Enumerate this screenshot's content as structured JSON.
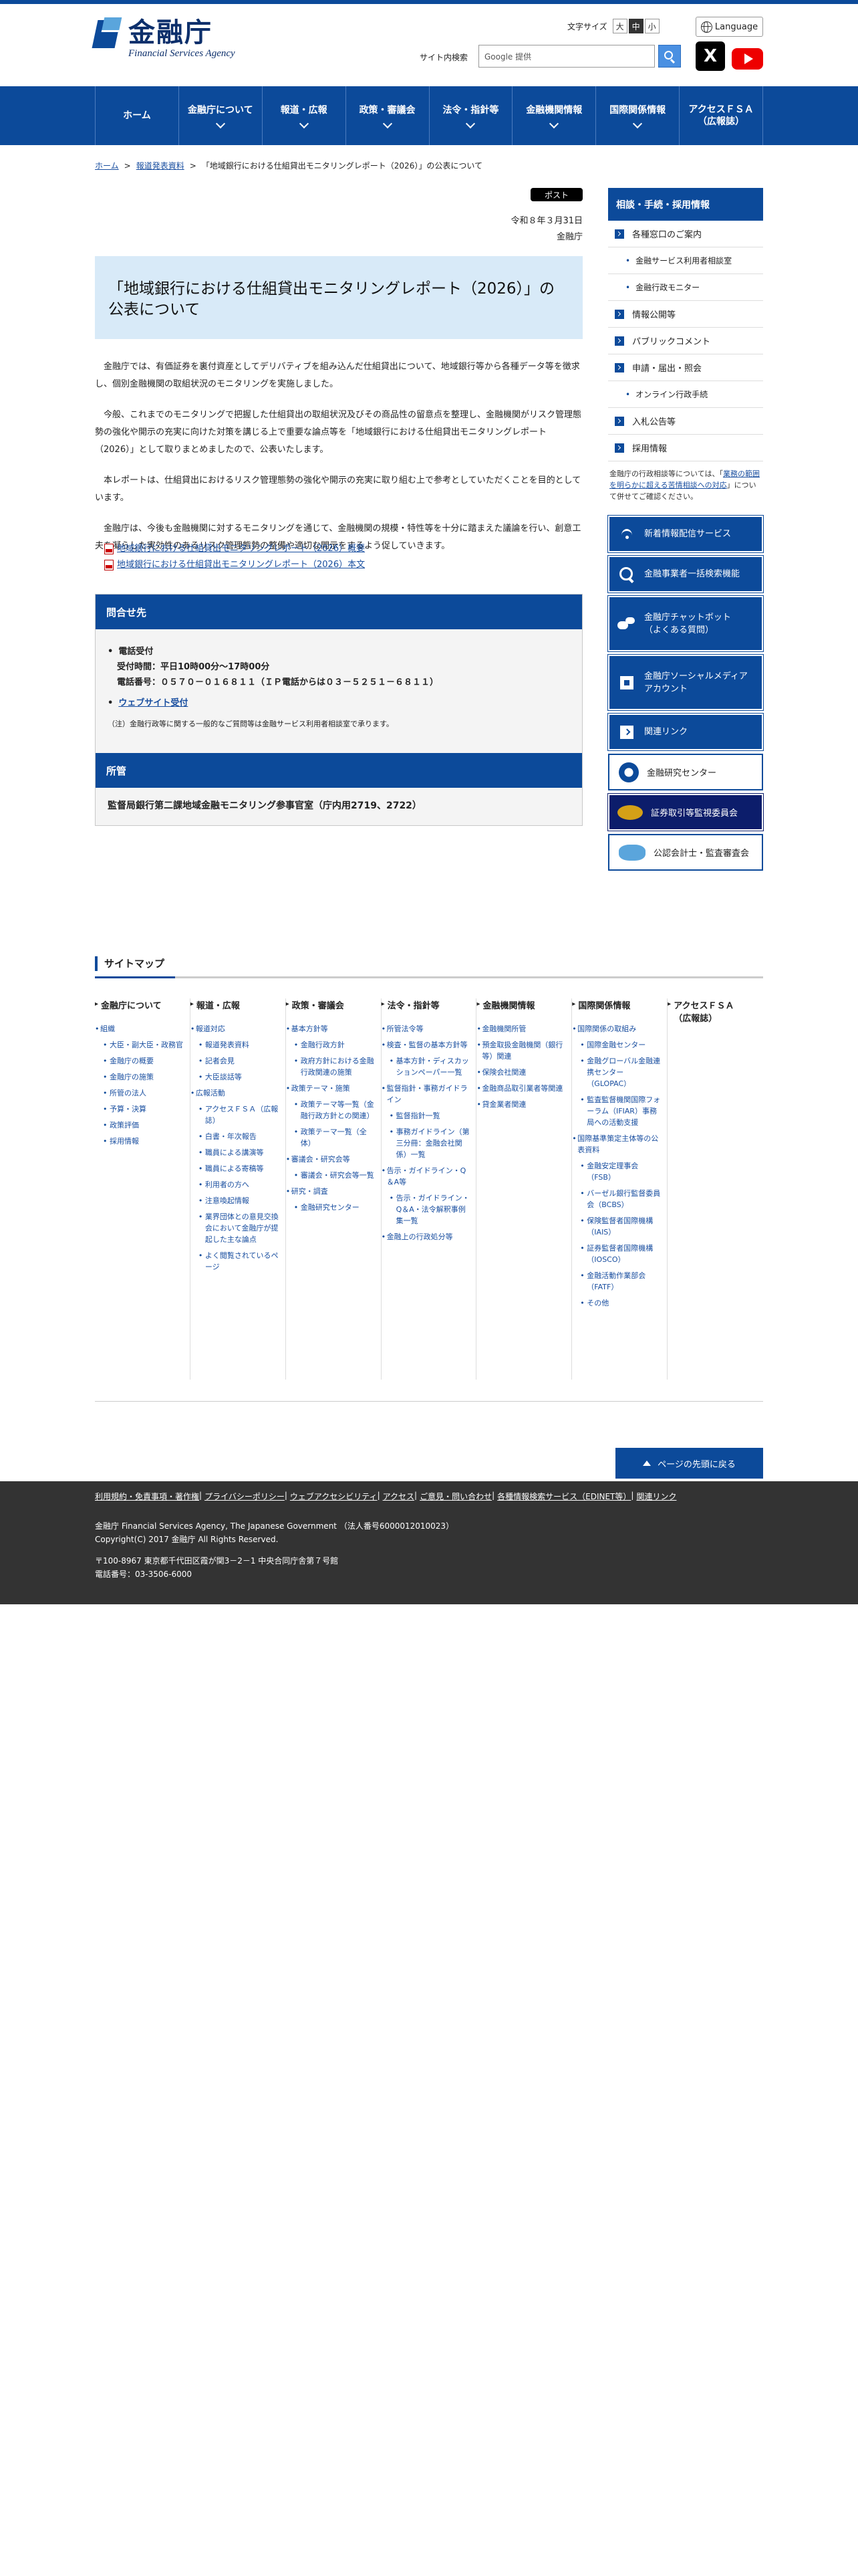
{
  "header": {
    "logo_ja": "金融庁",
    "logo_en": "Financial Services Agency",
    "font_size_label": "文字サイズ",
    "font_sizes": [
      "大",
      "中",
      "小"
    ],
    "language_label": "Language",
    "search_label": "サイト内検索",
    "search_placeholder": "Google 提供",
    "sns_x_label": "X"
  },
  "gnav": [
    "ホーム",
    "金融庁について",
    "報道・広報",
    "政策・審議会",
    "法令・指針等",
    "金融機関情報",
    "国際関係情報",
    "アクセスＦＳＡ\n（広報誌）"
  ],
  "breadcrumb": {
    "home": "ホーム",
    "sep": ">",
    "section": "報道発表資料",
    "current": "「地域銀行における仕組貸出モニタリングレポート（2026）」の公表について"
  },
  "article": {
    "post_button": "ポスト",
    "date": "令和８年３月31日",
    "publisher": "金融庁",
    "title": "「地域銀行における仕組貸出モニタリングレポート（2026）」の公表について",
    "paragraphs": [
      "金融庁では、有価証券を裏付資産としてデリバティブを組み込んだ仕組貸出について、地域銀行等から各種データ等を徴求し、個別金融機関の取組状況のモニタリングを実施しました。",
      "今般、これまでのモニタリングで把握した仕組貸出の取組状況及びその商品性の留意点を整理し、金融機関がリスク管理態勢の強化や開示の充実に向けた対策を講じる上で重要な論点等を「地域銀行における仕組貸出モニタリングレポート（2026）」として取りまとめましたので、公表いたします。",
      "本レポートは、仕組貸出におけるリスク管理態勢の強化や開示の充実に取り組む上で参考としていただくことを目的としています。",
      "金融庁は、今後も金融機関に対するモニタリングを通じて、金融機関の規模・特性等を十分に踏まえた議論を行い、創意工夫を凝らした実効性のあるリスク管理態勢の整備や適切な開示をするよう促していきます。"
    ],
    "pdf_links": [
      "地域銀行における仕組貸出モニタリングレポート（2026）概要",
      "地域銀行における仕組貸出モニタリングレポート（2026）本文"
    ]
  },
  "contact": {
    "heading": "問合せ先",
    "phone_title": "電話受付",
    "hours": "受付時間：平日10時00分～17時00分",
    "phone": "電話番号：０５７０－０１６８１１（ＩＰ電話からは０３－５２５１－６８１１）",
    "web_link": "ウェブサイト受付",
    "note": "（注）金融行政等に関する一般的なご質問等は金融サービス利用者相談室で承ります。",
    "dept_heading": "所管",
    "dept": "監督局銀行第二課地域金融モニタリング参事官室（庁内用2719、2722）"
  },
  "side": {
    "heading": "相談・手続・採用情報",
    "items": [
      {
        "label": "各種窓口のご案内",
        "type": "main"
      },
      {
        "label": "金融サービス利用者相談室",
        "type": "sub"
      },
      {
        "label": "金融行政モニター",
        "type": "sub"
      },
      {
        "label": "情報公開等",
        "type": "main"
      },
      {
        "label": "パブリックコメント",
        "type": "main"
      },
      {
        "label": "申請・届出・照会",
        "type": "main"
      },
      {
        "label": "オンライン行政手続",
        "type": "sub"
      },
      {
        "label": "入札公告等",
        "type": "main"
      },
      {
        "label": "採用情報",
        "type": "main"
      }
    ],
    "note_before": "金融庁の行政相談等については、「",
    "note_link": "業務の範囲を明らかに超える苦情相談への対応",
    "note_after": "」について併せてご確認ください。",
    "banners": [
      {
        "label": "新着情報配信サービス",
        "icon": "wifi-icon"
      },
      {
        "label": "金融事業者一括検索機能",
        "icon": "search-icon"
      },
      {
        "label": "金融庁チャットボット\n（よくある質問）",
        "icon": "chatbot-icon"
      },
      {
        "label": "金融庁ソーシャルメディア\nアカウント",
        "icon": "social-media-icon"
      },
      {
        "label": "関連リンク",
        "icon": "link-icon"
      }
    ],
    "banner_research": "金融研究センター",
    "banner_sesc": "証券取引等監視委員会",
    "banner_cpaaob": "公認会計士・監査審査会"
  },
  "sitemap": {
    "heading": "サイトマップ",
    "columns": [
      {
        "title": "金融庁について",
        "items": [
          [
            "組織",
            0
          ],
          [
            "大臣・副大臣・政務官",
            1
          ],
          [
            "金融庁の概要",
            1
          ],
          [
            "金融庁の施策",
            1
          ],
          [
            "所管の法人",
            1
          ],
          [
            "予算・決算",
            1
          ],
          [
            "政策評価",
            1
          ],
          [
            "採用情報",
            1
          ]
        ]
      },
      {
        "title": "報道・広報",
        "items": [
          [
            "報道対応",
            0
          ],
          [
            "報道発表資料",
            1
          ],
          [
            "記者会見",
            1
          ],
          [
            "大臣談話等",
            1
          ],
          [
            "広報活動",
            0
          ],
          [
            "アクセスＦＳＡ（広報誌）",
            1
          ],
          [
            "白書・年次報告",
            1
          ],
          [
            "職員による講演等",
            1
          ],
          [
            "職員による寄稿等",
            1
          ],
          [
            "利用者の方へ",
            1
          ],
          [
            "注意喚起情報",
            1
          ],
          [
            "業界団体との意見交換会において金融庁が提起した主な論点",
            1
          ],
          [
            "よく閲覧されているページ",
            1
          ]
        ]
      },
      {
        "title": "政策・審議会",
        "items": [
          [
            "基本方針等",
            0
          ],
          [
            "金融行政方針",
            1
          ],
          [
            "政府方針における金融行政関連の施策",
            1
          ],
          [
            "政策テーマ・施策",
            0
          ],
          [
            "政策テーマ等一覧（金融行政方針との関連）",
            1
          ],
          [
            "政策テーマ一覧（全体）",
            1
          ],
          [
            "審議会・研究会等",
            0
          ],
          [
            "審議会・研究会等一覧",
            1
          ],
          [
            "研究・調査",
            0
          ],
          [
            "金融研究センター",
            1
          ]
        ]
      },
      {
        "title": "法令・指針等",
        "items": [
          [
            "所管法令等",
            0
          ],
          [
            "検査・監督の基本方針等",
            0
          ],
          [
            "基本方針・ディスカッションペーパー一覧",
            1
          ],
          [
            "監督指針・事務ガイドライン",
            0
          ],
          [
            "監督指針一覧",
            1
          ],
          [
            "事務ガイドライン（第三分冊：金融会社関係）一覧",
            1
          ],
          [
            "告示・ガイドライン・Q＆A等",
            0
          ],
          [
            "告示・ガイドライン・Q＆A・法令解釈事例集一覧",
            1
          ],
          [
            "金融上の行政処分等",
            0
          ]
        ]
      },
      {
        "title": "金融機関情報",
        "items": [
          [
            "金融機関所管",
            0
          ],
          [
            "預金取扱金融機関（銀行等）関連",
            0
          ],
          [
            "保険会社関連",
            0
          ],
          [
            "金融商品取引業者等関連",
            0
          ],
          [
            "貸金業者関連",
            0
          ]
        ]
      },
      {
        "title": "国際関係情報",
        "items": [
          [
            "国際関係の取組み",
            0
          ],
          [
            "国際金融センター",
            1
          ],
          [
            "金融グローバル金融連携センター（GLOPAC）",
            1
          ],
          [
            "監査監督機関国際フォーラム（IFIAR）事務局への活動支援",
            1
          ],
          [
            "国際基準策定主体等の公表資料",
            0
          ],
          [
            "金融安定理事会（FSB）",
            1
          ],
          [
            "バーゼル銀行監督委員会（BCBS）",
            1
          ],
          [
            "保険監督者国際機構（IAIS）",
            1
          ],
          [
            "証券監督者国際機構（IOSCO）",
            1
          ],
          [
            "金融活動作業部会（FATF）",
            1
          ],
          [
            "その他",
            1
          ]
        ]
      },
      {
        "title": "アクセスＦＳＡ\n（広報誌）",
        "items": []
      }
    ]
  },
  "pagetop": "ページの先頭に戻る",
  "footer": {
    "links": [
      "利用規約・免責事項・著作権",
      "プライバシーポリシー",
      "ウェブアクセシビリティ",
      "アクセス",
      "ご意見・問い合わせ",
      "各種情報検索サービス（EDINET等）",
      "関連リンク"
    ],
    "org": "金融庁 Financial Services Agency, The Japanese Government （法人番号6000012010023）",
    "copyright": "Copyright(C) 2017 金融庁 All Rights Reserved.",
    "address": "〒100-8967 東京都千代田区霞が関3－2－1 中央合同庁舎第７号館",
    "tel": "電話番号：03-3506-6000"
  }
}
